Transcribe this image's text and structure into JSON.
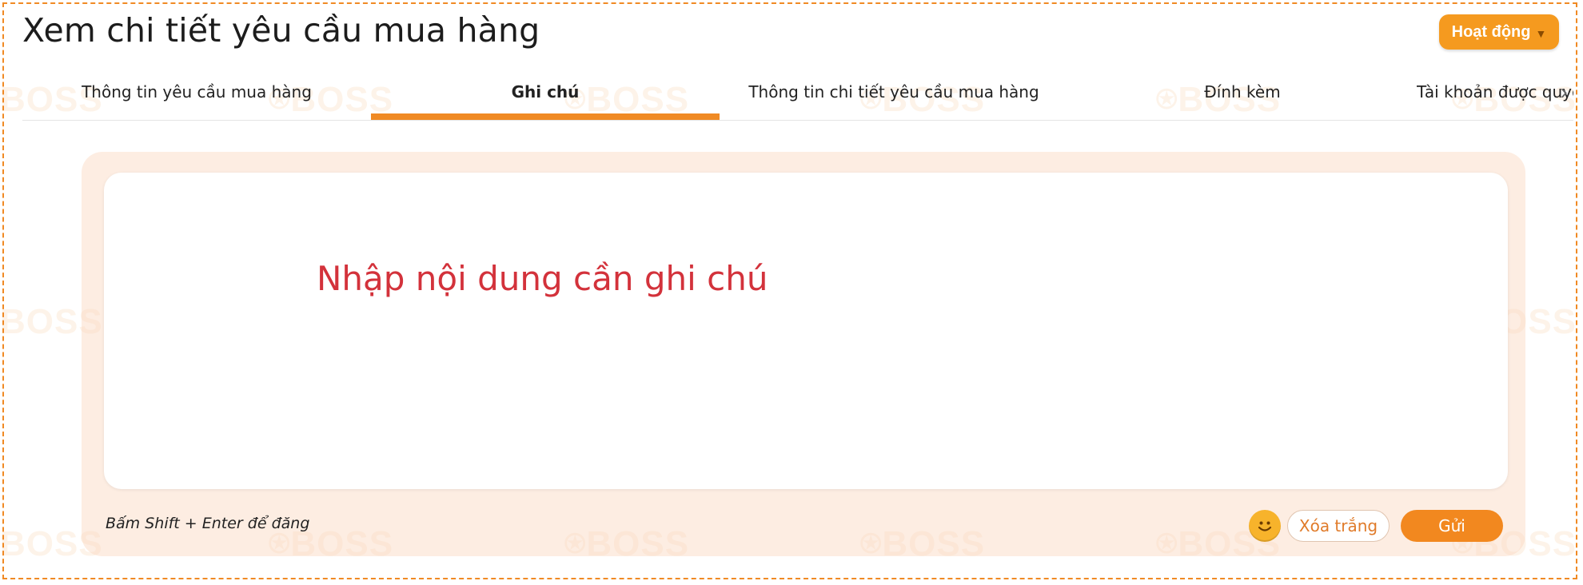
{
  "header": {
    "title": "Xem chi tiết yêu cầu mua hàng",
    "activity_button": "Hoạt động"
  },
  "tabs": [
    {
      "label": "Thông tin yêu cầu mua hàng",
      "active": false
    },
    {
      "label": "Ghi chú",
      "active": true
    },
    {
      "label": "Thông tin chi tiết yêu cầu mua hàng",
      "active": false
    },
    {
      "label": "Đính kèm",
      "active": false
    },
    {
      "label": "Tài khoản được quyền",
      "active": false
    }
  ],
  "note": {
    "placeholder": "Nhập nội dung cần ghi chú",
    "hint": "Bấm Shift + Enter để đăng",
    "clear_label": "Xóa trắng",
    "send_label": "Gửi"
  },
  "watermark_text": "BOSS",
  "icons": {
    "activity_caret": "caret-down-icon",
    "tabs_next": "chevron-right-icon",
    "emoji": "smiley-emoji-icon"
  },
  "colors": {
    "accent": "#f08a24",
    "placeholder": "#d3323b",
    "panel_bg": "#fde9dc"
  }
}
